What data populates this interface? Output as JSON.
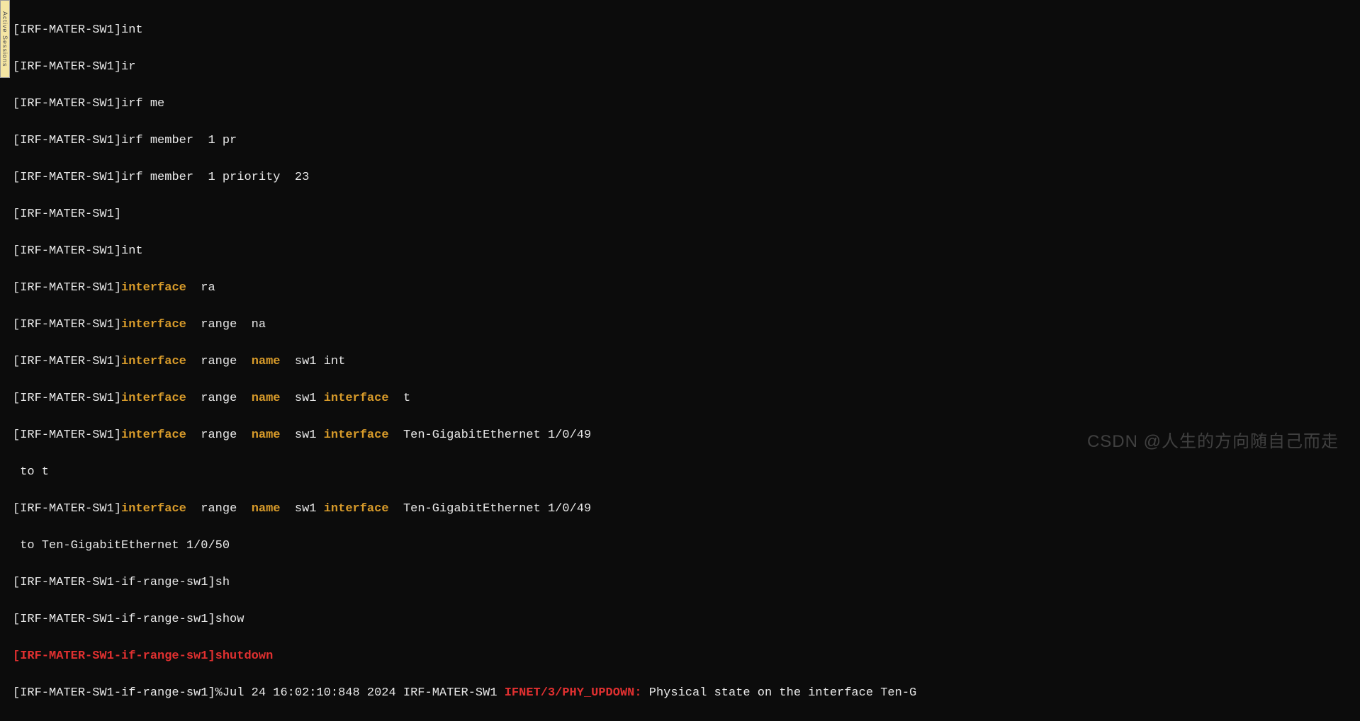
{
  "sidebar": {
    "label": "Active Sessions"
  },
  "prompt": "[IRF-MATER-SW1]",
  "prompt_range": "[IRF-MATER-SW1-if-range-sw1]",
  "lines": {
    "l1": "int",
    "l2": "ir",
    "l3": "irf me",
    "l4": "irf member  1 pr",
    "l5": "irf member  1 priority  23",
    "l6": "",
    "l7": "int",
    "l8a": "interface",
    "l8b": "  ra",
    "l9a": "interface",
    "l9b": "  range  na",
    "l10a": "interface",
    "l10b": "  range  ",
    "l10c": "name",
    "l10d": "  sw1 int",
    "l11a": "interface",
    "l11b": "  range  ",
    "l11c": "name",
    "l11d": "  sw1 ",
    "l11e": "interface",
    "l11f": "  t",
    "l12a": "interface",
    "l12b": "  range  ",
    "l12c": "name",
    "l12d": "  sw1 ",
    "l12e": "interface",
    "l12f": "  Ten-GigabitEthernet 1/0/49",
    "l12g": " to t",
    "l13a": "interface",
    "l13b": "  range  ",
    "l13c": "name",
    "l13d": "  sw1 ",
    "l13e": "interface",
    "l13f": "  Ten-GigabitEthernet 1/0/49",
    "l13g": " to Ten-GigabitEthernet 1/0/50",
    "l14": "sh",
    "l15": "show",
    "l16": "shutdown",
    "l17a": "%Jul 24 16:02:10:848 2024 IRF-MATER-SW1 ",
    "l17b": "IFNET/3/PHY_UPDOWN:",
    "l17c": " Physical state on the interface Ten-G"
  },
  "watermark": "CSDN @人生的方向随自己而走"
}
